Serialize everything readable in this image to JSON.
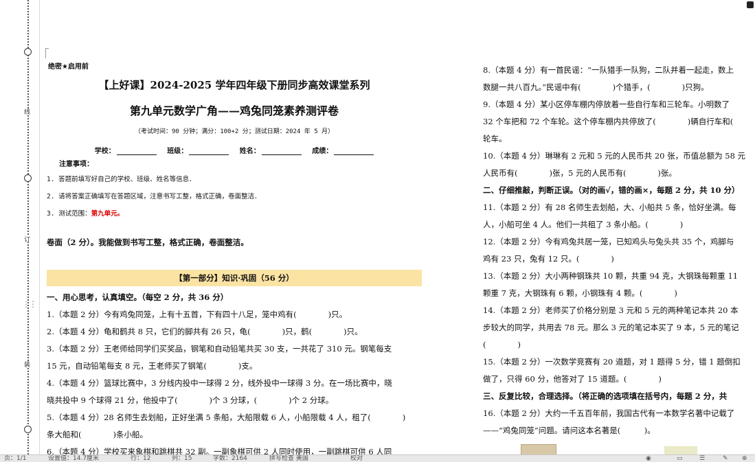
{
  "binding": {
    "labels": [
      "线",
      "订",
      "装"
    ]
  },
  "header": {
    "secret": "绝密★启用前",
    "title1": "【上好课】2024-2025 学年四年级下册同步高效课堂系列",
    "title2": "第九单元数学广角——鸡兔同笼素养测评卷",
    "exam_info": "（考试时间：90 分钟；满分：100+2 分；测试日期：2024 年 5 月）",
    "fields": [
      "学校：",
      "班级：",
      "姓名：",
      "成绩："
    ],
    "notes_title": "注意事项：",
    "notes": [
      "1. 答题前填写好自己的学校、班级、姓名等信息．",
      "2. 请将答案正确填写在答题区域，注意书写工整，格式正确，卷面整洁．"
    ],
    "note3_prefix": "3. 测试范围：",
    "note3_value": "第九单元。"
  },
  "neatness": "卷面（2 分）。我能做到书写工整，格式正确，卷面整洁。",
  "part1_title": "【第一部分】知识·巩固（56 分）",
  "section1_title": "一、用心思考，认真填空。（每空 2 分，共 36 分）",
  "left_questions": [
    "1.（本题 2 分）今有鸡兔同笼，上有十五首，下有四十八足，笼中鸡有(　　　　)只。",
    "2.（本题 4 分）龟和鹤共 8 只，它们的脚共有 26 只，龟(　　　　)只，鹤(　　　　)只。",
    "3.（本题 2 分）王老师给同学们买奖品，钢笔和自动铅笔共买 30 支，一共花了 310 元。钢笔每支",
    "15 元，自动铅笔每支 8 元，王老师买了钢笔(　　　　)支。",
    "4.（本题 4 分）篮球比赛中，3 分线内投中一球得 2 分，线外投中一球得 3 分。在一场比赛中，晓",
    "晓共投中 9 个球得 21 分，他投中了(　　　　)个 3 分球，(　　　　)个 2 分球。",
    "5.（本题 4 分）28 名师生去划船，正好坐满 5 条船，大船限载 6 人，小船限载 4 人，租了(　　　　)",
    "条大船和(　　　　)条小船。",
    "6.（本题 4 分）学校买来象棋和跳棋共 32 副。一副象棋可供 2 人同时使用，一副跳棋可供 6 人同"
  ],
  "right_lines": [
    {
      "t": "q",
      "text": "8.（本题 4 分）有一首民谣：“一队猎手一队狗，二队并着一起走，数上"
    },
    {
      "t": "q",
      "text": "数腿一共八百九。”民谣中有(　　　　)个猎手，(　　　　)只狗。"
    },
    {
      "t": "q",
      "text": "9.（本题 4 分）某小区停车棚内停放着一些自行车和三轮车。小明数了"
    },
    {
      "t": "q",
      "text": "32 个车把和 72 个车轮。这个停车棚内共停放了(　　　　)辆自行车和("
    },
    {
      "t": "q",
      "text": "轮车。"
    },
    {
      "t": "q",
      "text": "10.（本题 4 分）琳琳有 2 元和 5 元的人民币共 20 张，币值总额为 58 元"
    },
    {
      "t": "q",
      "text": "人民币有(　　　　)张，5 元的人民币有(　　　　)张。"
    },
    {
      "t": "s",
      "text": "二、仔细推敲，判断正误。（对的画√，错的画×，每题 2 分，共 10 分）"
    },
    {
      "t": "q",
      "text": "11.（本题 2 分）有 28 名师生去划船，大、小船共 5 条，恰好坐满。每"
    },
    {
      "t": "q",
      "text": "人，小船可坐 4 人。他们一共租了 3 条小船。(　　　　)"
    },
    {
      "t": "q",
      "text": "12.（本题 2 分）今有鸡兔共居一笼，已知鸡头与兔头共 35 个，鸡脚与"
    },
    {
      "t": "q",
      "text": "鸡有 23 只，兔有 12 只。(　　　　)"
    },
    {
      "t": "q",
      "text": "13.（本题 2 分）大小两种钢珠共 10 颗，共重 94 克，大钢珠每颗重 11"
    },
    {
      "t": "q",
      "text": "颗重 7 克，大钢珠有 6 颗，小钢珠有 4 颗。(　　　　)"
    },
    {
      "t": "q",
      "text": "14.（本题 2 分）老师买了价格分别是 3 元和 5 元的两种笔记本共 20 本"
    },
    {
      "t": "q",
      "text": "步较大的同学，共用去 78 元。那么 3 元的笔记本买了 9 本，5 元的笔记"
    },
    {
      "t": "q",
      "text": "(　　　　)"
    },
    {
      "t": "q",
      "text": "15.（本题 2 分）一次数学竞赛有 20 道题，对 1 题得 5 分，错 1 题倒扣"
    },
    {
      "t": "q",
      "text": "做了，只得 60 分，他答对了 15 道题。(　　　　)"
    },
    {
      "t": "s",
      "text": "三、反复比较，合理选择。（将正确的选项填在括号内，每题 2 分，共"
    },
    {
      "t": "q",
      "text": "16.（本题 2 分）大约一千五百年前，我国古代有一本数学名著中记载了"
    },
    {
      "t": "q",
      "text": "——“鸡兔同笼”问题。请问这本名著是(　　　)。"
    }
  ],
  "status_bar": {
    "page": "页：1/1",
    "mode": "设置值：14.7厘米",
    "row": "行：12",
    "col": "列：15",
    "words": "字数：2164",
    "spell": "拼写检查 美国",
    "check": "校对"
  }
}
